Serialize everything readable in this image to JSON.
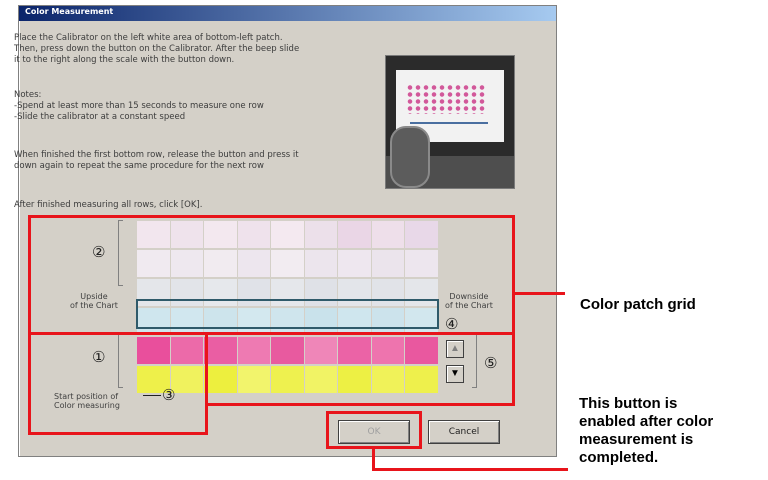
{
  "dialog": {
    "title": "Color Measurement",
    "instructions": [
      "Place the Calibrator on the left white area of bottom-left patch.",
      "Then, press down the button on the Calibrator. After the beep slide",
      "it to the right along the scale with the button down.",
      "",
      "Notes:",
      "-Spend at least more than 15 seconds to measure one row",
      "-Slide the calibrator at a constant speed",
      "",
      "When finished the first bottom row,  release the button and press it",
      "down again to repeat the same procedure for the next row",
      "",
      "After finished measuring all rows, click [OK]."
    ],
    "labels": {
      "upside": "Upside\nof the Chart",
      "downside": "Downside\nof the Chart",
      "start_position": "Start position of\nColor measuring"
    },
    "markers": {
      "m1": "①",
      "m2": "②",
      "m3": "③",
      "m4": "④",
      "m5": "⑤"
    },
    "scroll_up_icon": "▲",
    "scroll_down_icon": "▼",
    "buttons": {
      "ok": "OK",
      "cancel": "Cancel"
    }
  },
  "grid": {
    "rows": [
      [
        "#f2e6ee",
        "#efe3ec",
        "#f3e8ef",
        "#efe2ec",
        "#f4e9f0",
        "#ece0ea",
        "#ead6e6",
        "#eedfea",
        "#e8d8e8"
      ],
      [
        "#f0eaf0",
        "#eee8ef",
        "#f1ebf0",
        "#ede6ee",
        "#f2ecf1",
        "#ece5ed",
        "#eee7ef",
        "#ebe4ec",
        "#ede6ee"
      ],
      [
        "#e4e6ea",
        "#e2e4e9",
        "#e6e8ec",
        "#e0e2e8",
        "#e5e7eb",
        "#dfe1e7",
        "#e3e5ea",
        "#e1e3e8",
        "#e4e6ea"
      ],
      [
        "#cfe6ee",
        "#d1e7ef",
        "#cde4ec",
        "#d3e8ef",
        "#cfe5ed",
        "#c9e2eb",
        "#cfe6ee",
        "#cce3ec",
        "#d2e7ee"
      ],
      [
        "#e94f9c",
        "#ec6aa9",
        "#ea5ea3",
        "#ee7ab2",
        "#e85a9f",
        "#ef86b8",
        "#eb63a6",
        "#ee74ae",
        "#e9589f"
      ],
      [
        "#eef04a",
        "#f0f25e",
        "#edef3e",
        "#f2f46c",
        "#eef14f",
        "#f1f365",
        "#edf044",
        "#f0f259",
        "#eef04c"
      ]
    ],
    "highlighted_row": 3
  },
  "callouts": {
    "grid": "Color patch grid",
    "button": "This button is\nenabled after color\nmeasurement is\ncompleted."
  },
  "colors": {
    "annotation_red": "#e8141b",
    "dialog_bg": "#d4d0c8",
    "titlebar_start": "#0a246a",
    "titlebar_end": "#a6caf0"
  }
}
